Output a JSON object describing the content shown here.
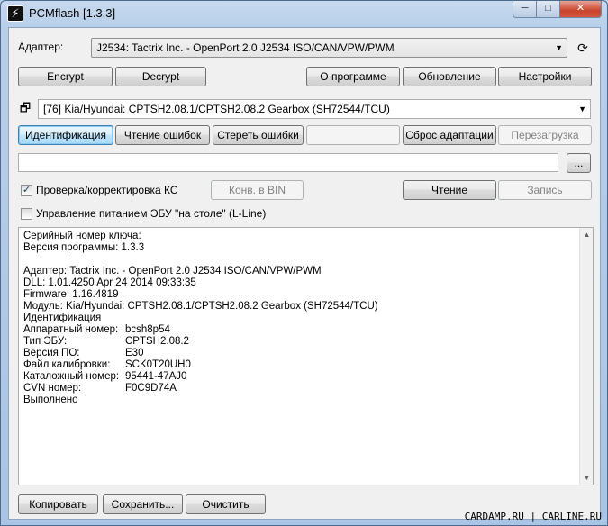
{
  "window": {
    "title": "PCMflash [1.3.3]",
    "icon": "lightning-icon",
    "controls": {
      "minimize": "─",
      "maximize": "□",
      "close": "✕"
    }
  },
  "adapter": {
    "label": "Адаптер:",
    "value": "J2534: Tactrix Inc. - OpenPort 2.0 J2534 ISO/CAN/VPW/PWM",
    "refresh_icon": "refresh-icon"
  },
  "top_buttons": {
    "encrypt": "Encrypt",
    "decrypt": "Decrypt",
    "about": "О программе",
    "update": "Обновление",
    "settings": "Настройки"
  },
  "module": {
    "value": "[76] Kia/Hyundai: CPTSH2.08.1/CPTSH2.08.2 Gearbox (SH72544/TCU)",
    "icon": "window-restore-icon"
  },
  "action_buttons": {
    "identify": "Идентификация",
    "read_errors": "Чтение ошибок",
    "clear_errors": "Стереть ошибки",
    "blank": "",
    "reset_adapt": "Сброс адаптации",
    "reboot": "Перезагрузка"
  },
  "file": {
    "path": "",
    "browse": "..."
  },
  "options": {
    "checksum_label": "Проверка/корректировка КС",
    "checksum_checked": true,
    "convert_bin": "Конв. в BIN",
    "read": "Чтение",
    "write": "Запись",
    "power_label": "Управление питанием ЭБУ \"на столе\" (L-Line)",
    "power_checked": false
  },
  "log": {
    "lines": [
      "Серийный номер ключа:",
      "Версия программы: 1.3.3",
      "",
      "Адаптер: Tactrix Inc. - OpenPort 2.0 J2534 ISO/CAN/VPW/PWM",
      "DLL: 1.01.4250 Apr 24 2014 09:33:35",
      "Firmware: 1.16.4819",
      "Модуль: Kia/Hyundai: CPTSH2.08.1/CPTSH2.08.2 Gearbox (SH72544/TCU)",
      "Идентификация"
    ],
    "kv": [
      {
        "k": "Аппаратный номер:",
        "v": "bcsh8p54"
      },
      {
        "k": "Тип ЭБУ:",
        "v": "CPTSH2.08.2"
      },
      {
        "k": "Версия ПО:",
        "v": "E30"
      },
      {
        "k": "Файл калибровки:",
        "v": "SCK0T20UH0"
      },
      {
        "k": "Каталожный номер:",
        "v": "95441-47AJ0"
      },
      {
        "k": "CVN номер:",
        "v": "F0C9D74A"
      }
    ],
    "done": "Выполнено"
  },
  "bottom_buttons": {
    "copy": "Копировать",
    "save": "Сохранить...",
    "clear": "Очистить"
  },
  "watermark": "CARDAMP.RU | CARLINE.RU"
}
